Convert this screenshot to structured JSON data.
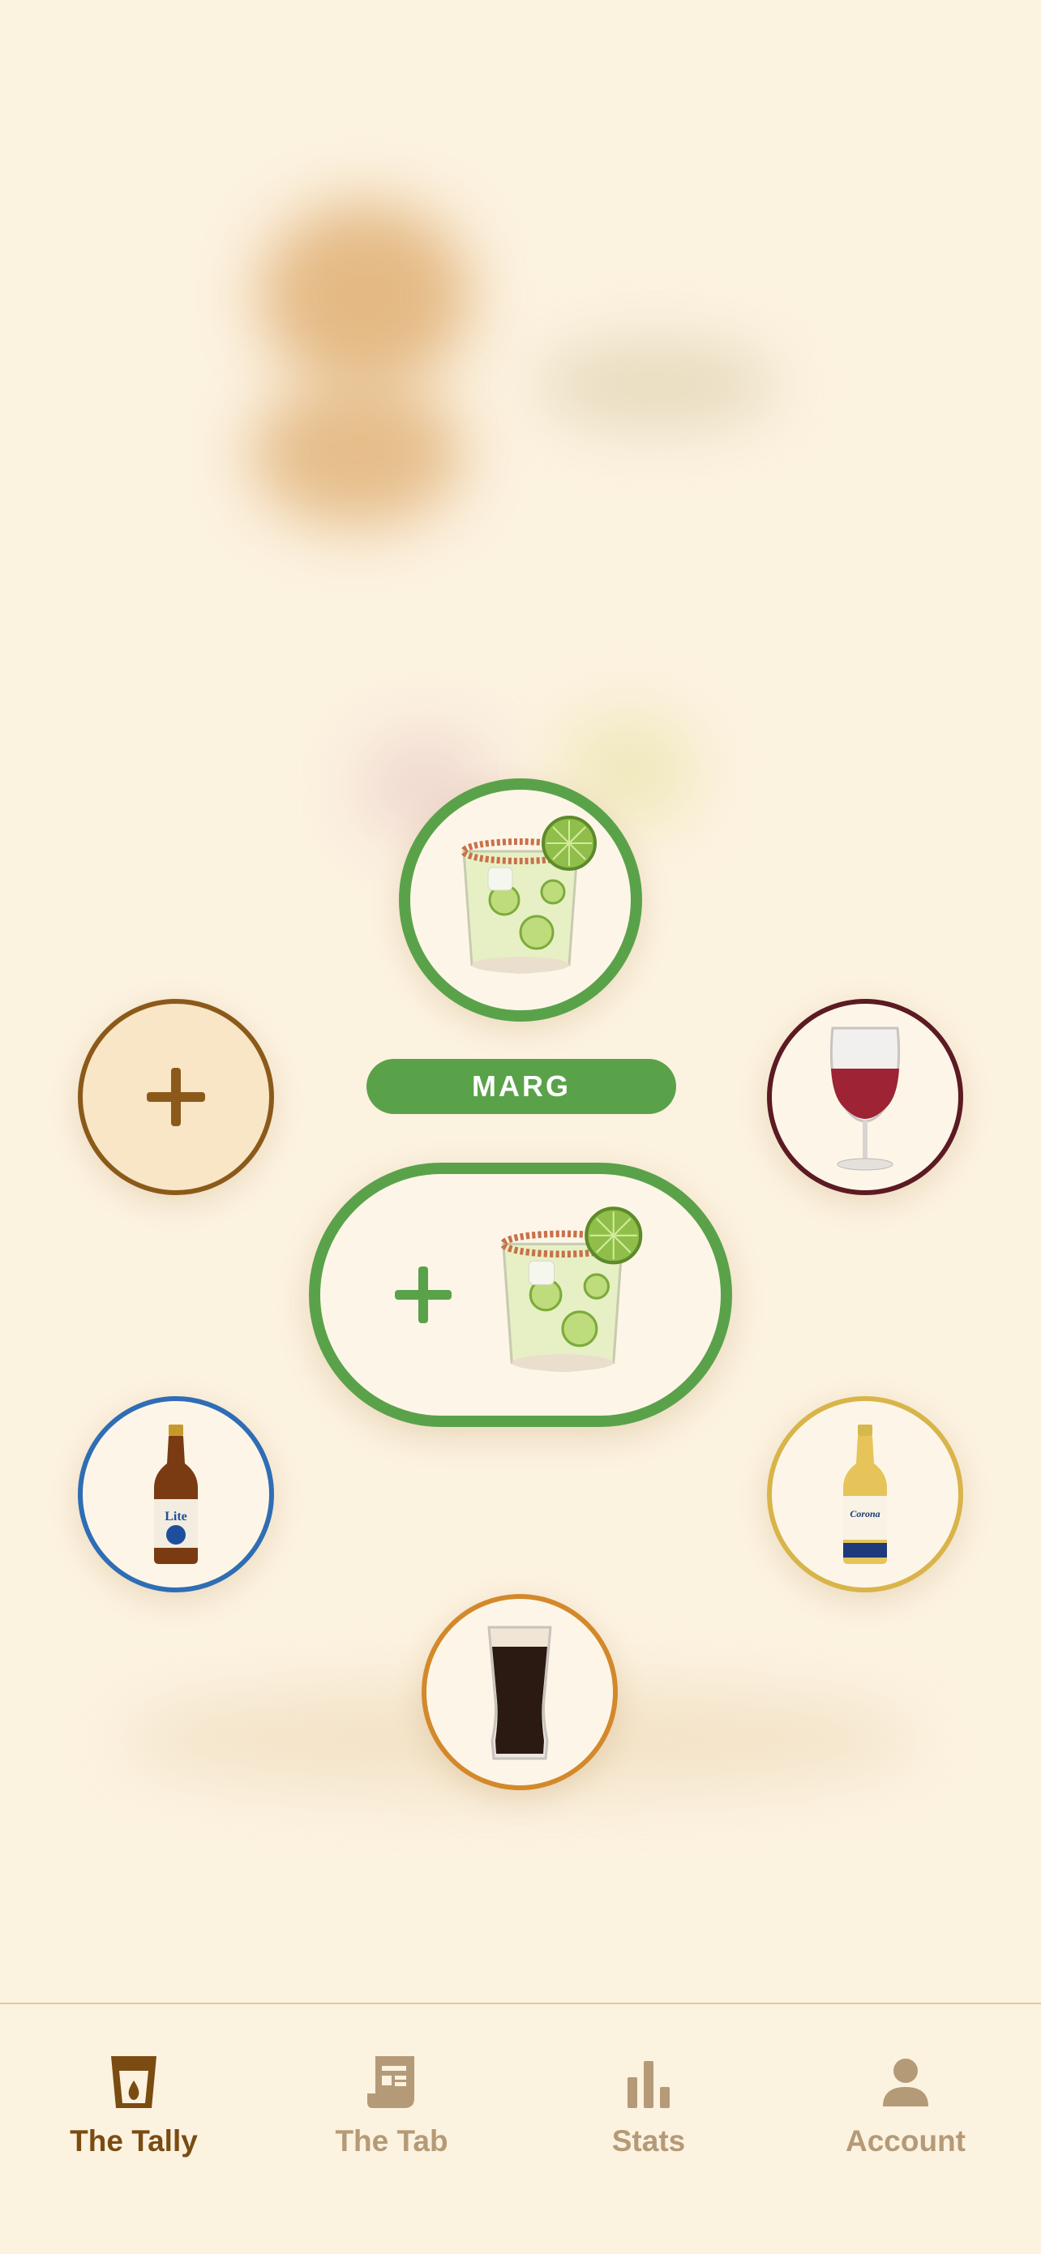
{
  "selected_drink": {
    "label": "MARG",
    "accent": "#5aa24a",
    "icon": "margarita-icon"
  },
  "drink_options": [
    {
      "name": "margarita",
      "icon": "margarita-icon",
      "ring_color": "#5aa24a",
      "selected": true
    },
    {
      "name": "add-drink",
      "icon": "plus-icon",
      "ring_color": "#8b5a1a"
    },
    {
      "name": "red-wine",
      "icon": "wine-glass-icon",
      "ring_color": "#5c1a22"
    },
    {
      "name": "miller-lite",
      "icon": "beer-bottle-icon",
      "ring_color": "#2f6db5"
    },
    {
      "name": "corona",
      "icon": "beer-bottle-icon",
      "ring_color": "#d8b44a"
    },
    {
      "name": "stout",
      "icon": "pint-glass-icon",
      "ring_color": "#d3892b"
    }
  ],
  "bottle_labels": {
    "lite": "Lite",
    "corona": "Corona"
  },
  "nav": {
    "items": [
      {
        "label": "The Tally",
        "icon": "cup-icon",
        "active": true
      },
      {
        "label": "The Tab",
        "icon": "receipt-icon",
        "active": false
      },
      {
        "label": "Stats",
        "icon": "bar-chart-icon",
        "active": false
      },
      {
        "label": "Account",
        "icon": "person-icon",
        "active": false
      }
    ]
  },
  "colors": {
    "background": "#fcf2e0",
    "nav_active": "#7a4c12",
    "nav_inactive": "#b59a77"
  }
}
